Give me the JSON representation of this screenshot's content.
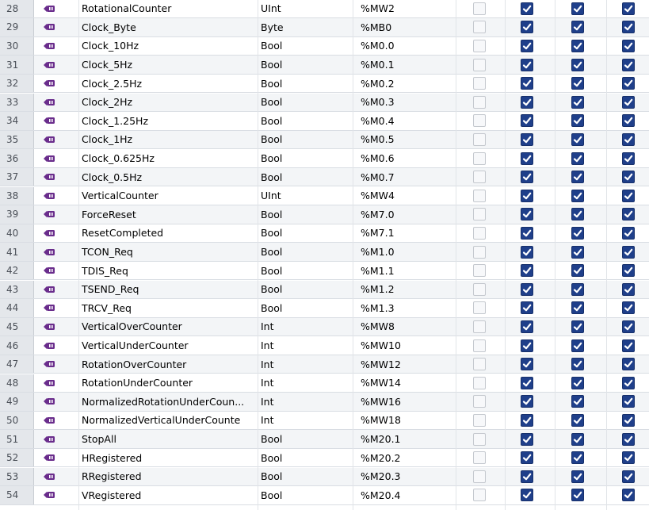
{
  "rows": [
    {
      "no": "28",
      "name": "RotationalCounter",
      "type": "UInt",
      "address": "%MW2"
    },
    {
      "no": "29",
      "name": "Clock_Byte",
      "type": "Byte",
      "address": "%MB0"
    },
    {
      "no": "30",
      "name": "Clock_10Hz",
      "type": "Bool",
      "address": "%M0.0"
    },
    {
      "no": "31",
      "name": "Clock_5Hz",
      "type": "Bool",
      "address": "%M0.1"
    },
    {
      "no": "32",
      "name": "Clock_2.5Hz",
      "type": "Bool",
      "address": "%M0.2"
    },
    {
      "no": "33",
      "name": "Clock_2Hz",
      "type": "Bool",
      "address": "%M0.3"
    },
    {
      "no": "34",
      "name": "Clock_1.25Hz",
      "type": "Bool",
      "address": "%M0.4"
    },
    {
      "no": "35",
      "name": "Clock_1Hz",
      "type": "Bool",
      "address": "%M0.5"
    },
    {
      "no": "36",
      "name": "Clock_0.625Hz",
      "type": "Bool",
      "address": "%M0.6"
    },
    {
      "no": "37",
      "name": "Clock_0.5Hz",
      "type": "Bool",
      "address": "%M0.7"
    },
    {
      "no": "38",
      "name": "VerticalCounter",
      "type": "UInt",
      "address": "%MW4"
    },
    {
      "no": "39",
      "name": "ForceReset",
      "type": "Bool",
      "address": "%M7.0"
    },
    {
      "no": "40",
      "name": "ResetCompleted",
      "type": "Bool",
      "address": "%M7.1"
    },
    {
      "no": "41",
      "name": "TCON_Req",
      "type": "Bool",
      "address": "%M1.0"
    },
    {
      "no": "42",
      "name": "TDIS_Req",
      "type": "Bool",
      "address": "%M1.1"
    },
    {
      "no": "43",
      "name": "TSEND_Req",
      "type": "Bool",
      "address": "%M1.2"
    },
    {
      "no": "44",
      "name": "TRCV_Req",
      "type": "Bool",
      "address": "%M1.3"
    },
    {
      "no": "45",
      "name": "VerticalOverCounter",
      "type": "Int",
      "address": "%MW8"
    },
    {
      "no": "46",
      "name": "VerticalUnderCounter",
      "type": "Int",
      "address": "%MW10"
    },
    {
      "no": "47",
      "name": "RotationOverCounter",
      "type": "Int",
      "address": "%MW12"
    },
    {
      "no": "48",
      "name": "RotationUnderCounter",
      "type": "Int",
      "address": "%MW14"
    },
    {
      "no": "49",
      "name": "NormalizedRotationUnderCoun...",
      "type": "Int",
      "address": "%MW16"
    },
    {
      "no": "50",
      "name": "NormalizedVerticalUnderCounte",
      "type": "Int",
      "address": "%MW18"
    },
    {
      "no": "51",
      "name": "StopAll",
      "type": "Bool",
      "address": "%M20.1"
    },
    {
      "no": "52",
      "name": "HRegistered",
      "type": "Bool",
      "address": "%M20.2"
    },
    {
      "no": "53",
      "name": "RRegistered",
      "type": "Bool",
      "address": "%M20.3"
    },
    {
      "no": "54",
      "name": "VRegistered",
      "type": "Bool",
      "address": "%M20.4"
    }
  ],
  "checkboxes": {
    "retain": false,
    "accessible_from_hmi": true,
    "writable_from_hmi": true,
    "visible_in_hmi": true
  },
  "icon": "tag-variable-icon",
  "colors": {
    "checkbox_on": "#1f3f8a",
    "row_alt": "#f3f5f7",
    "number_col": "#e4e7eb"
  }
}
